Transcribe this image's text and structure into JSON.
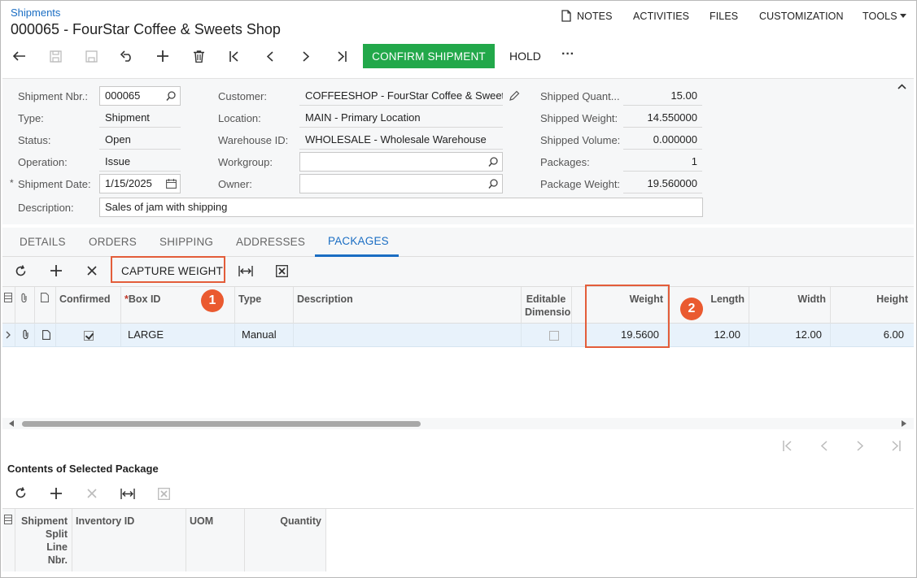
{
  "header": {
    "breadcrumb": "Shipments",
    "title": "000065 - FourStar Coffee & Sweets Shop",
    "top_menu": [
      "NOTES",
      "ACTIVITIES",
      "FILES",
      "CUSTOMIZATION",
      "TOOLS"
    ]
  },
  "toolbar": {
    "confirm_label": "CONFIRM SHIPMENT",
    "hold_label": "HOLD",
    "more_label": "···",
    "accent": "#22a84a"
  },
  "form": {
    "shipment_nbr_label": "Shipment Nbr.:",
    "shipment_nbr": "000065",
    "type_label": "Type:",
    "type": "Shipment",
    "status_label": "Status:",
    "status": "Open",
    "operation_label": "Operation:",
    "operation": "Issue",
    "shipment_date_label": "Shipment Date:",
    "shipment_date": "1/15/2025",
    "description_label": "Description:",
    "description": "Sales of jam with shipping",
    "customer_label": "Customer:",
    "customer": "COFFEESHOP - FourStar Coffee & Sweets Shop",
    "location_label": "Location:",
    "location": "MAIN - Primary Location",
    "warehouse_label": "Warehouse ID:",
    "warehouse": "WHOLESALE - Wholesale Warehouse",
    "workgroup_label": "Workgroup:",
    "workgroup": "",
    "owner_label": "Owner:",
    "owner": "",
    "shipped_qty_label": "Shipped Quant...",
    "shipped_qty": "15.00",
    "shipped_weight_label": "Shipped Weight:",
    "shipped_weight": "14.550000",
    "shipped_volume_label": "Shipped Volume:",
    "shipped_volume": "0.000000",
    "packages_label": "Packages:",
    "packages": "1",
    "package_weight_label": "Package Weight:",
    "package_weight": "19.560000"
  },
  "tabs": [
    "DETAILS",
    "ORDERS",
    "SHIPPING",
    "ADDRESSES",
    "PACKAGES"
  ],
  "packages_grid": {
    "capture_weight_label": "CAPTURE WEIGHT",
    "columns": {
      "confirmed": "Confirmed",
      "box_id": "Box ID",
      "type": "Type",
      "description": "Description",
      "editable_dimensions_1": "Editable",
      "editable_dimensions_2": "Dimensions",
      "weight": "Weight",
      "length": "Length",
      "width": "Width",
      "height": "Height"
    },
    "rows": [
      {
        "box_id": "LARGE",
        "type": "Manual",
        "description": "",
        "weight": "19.5600",
        "length": "12.00",
        "width": "12.00",
        "height": "6.00"
      }
    ]
  },
  "callouts": {
    "one": "1",
    "two": "2",
    "color": "#ea5a30"
  },
  "contents": {
    "title": "Contents of Selected Package",
    "columns": {
      "split_line_1": "Shipment",
      "split_line_2": "Split",
      "split_line_3": "Line",
      "split_line_4": "Nbr.",
      "inventory_id": "Inventory ID",
      "uom": "UOM",
      "quantity": "Quantity"
    }
  }
}
